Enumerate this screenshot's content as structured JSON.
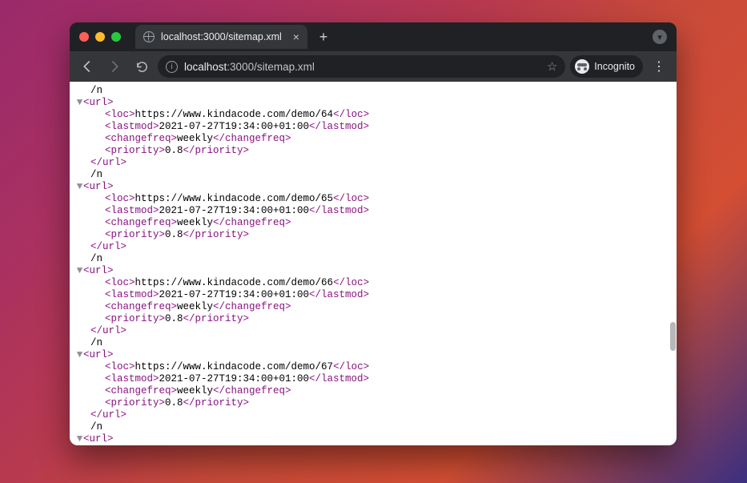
{
  "tab": {
    "title": "localhost:3000/sitemap.xml"
  },
  "address": {
    "host": "localhost",
    "path": ":3000/sitemap.xml"
  },
  "incognito_label": "Incognito",
  "xml": {
    "tags": {
      "url_open": "<url>",
      "url_close": "</url>",
      "loc_open": "<loc>",
      "loc_close": "</loc>",
      "lastmod_open": "<lastmod>",
      "lastmod_close": "</lastmod>",
      "changefreq_open": "<changefreq>",
      "changefreq_close": "</changefreq>",
      "priority_open": "<priority>",
      "priority_close": "</priority>"
    },
    "separator": "/n",
    "entries": [
      {
        "loc": "https://www.kindacode.com/demo/64",
        "lastmod": "2021-07-27T19:34:00+01:00",
        "changefreq": "weekly",
        "priority": "0.8"
      },
      {
        "loc": "https://www.kindacode.com/demo/65",
        "lastmod": "2021-07-27T19:34:00+01:00",
        "changefreq": "weekly",
        "priority": "0.8"
      },
      {
        "loc": "https://www.kindacode.com/demo/66",
        "lastmod": "2021-07-27T19:34:00+01:00",
        "changefreq": "weekly",
        "priority": "0.8"
      },
      {
        "loc": "https://www.kindacode.com/demo/67",
        "lastmod": "2021-07-27T19:34:00+01:00",
        "changefreq": "weekly",
        "priority": "0.8"
      }
    ]
  }
}
